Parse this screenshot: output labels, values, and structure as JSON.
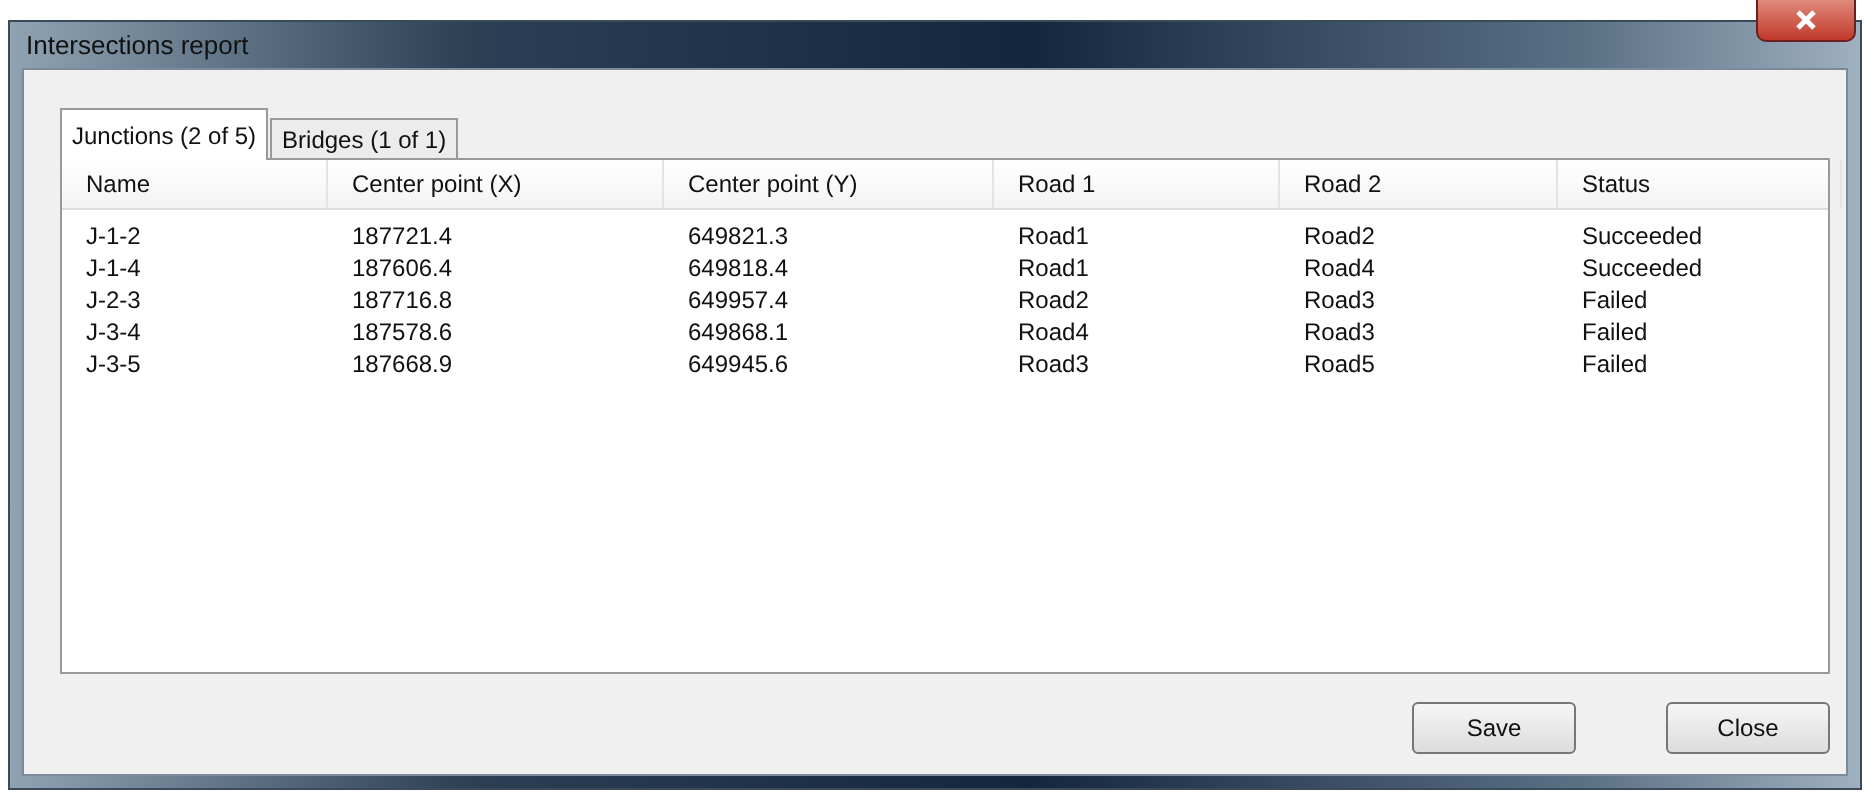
{
  "window": {
    "title": "Intersections report"
  },
  "tabs": [
    {
      "label": "Junctions (2 of 5)",
      "selected": true
    },
    {
      "label": "Bridges (1 of 1)",
      "selected": false
    }
  ],
  "table": {
    "columns": [
      "Name",
      "Center point (X)",
      "Center point (Y)",
      "Road 1",
      "Road 2",
      "Status"
    ],
    "rows": [
      [
        "J-1-2",
        "187721.4",
        "649821.3",
        "Road1",
        "Road2",
        "Succeeded"
      ],
      [
        "J-1-4",
        "187606.4",
        "649818.4",
        "Road1",
        "Road4",
        "Succeeded"
      ],
      [
        "J-2-3",
        "187716.8",
        "649957.4",
        "Road2",
        "Road3",
        "Failed"
      ],
      [
        "J-3-4",
        "187578.6",
        "649868.1",
        "Road4",
        "Road3",
        "Failed"
      ],
      [
        "J-3-5",
        "187668.9",
        "649945.6",
        "Road3",
        "Road5",
        "Failed"
      ]
    ]
  },
  "buttons": [
    "Save",
    "Close"
  ]
}
